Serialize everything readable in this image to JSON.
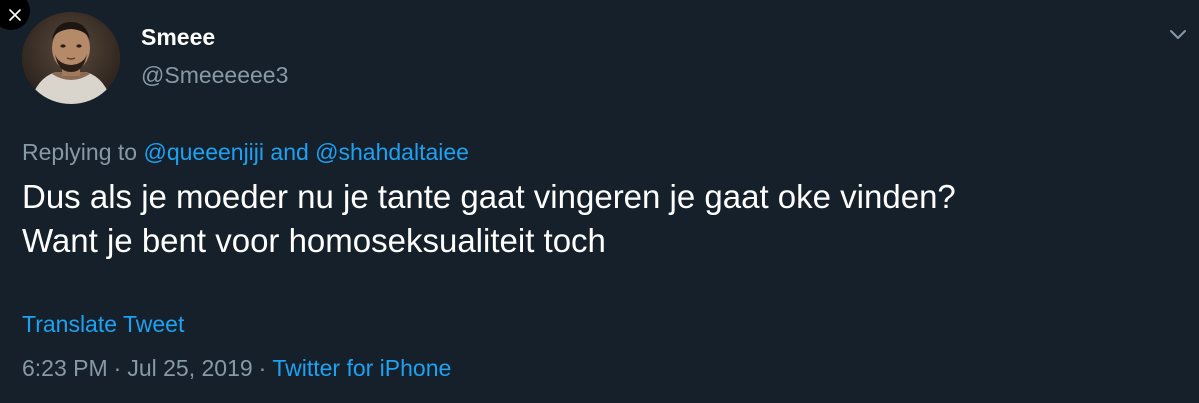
{
  "user": {
    "display_name": "Smeee",
    "handle": "@Smeeeeee3"
  },
  "reply": {
    "prefix": "Replying to",
    "mention_1": "@queeenjiji",
    "conjunction": "and",
    "mention_2": "@shahdaltaiee"
  },
  "tweet": {
    "lines": [
      "Dus als je moeder nu je tante gaat vingeren je gaat oke vinden?",
      "Want je bent voor homoseksualiteit toch"
    ]
  },
  "translate_label": "Translate Tweet",
  "meta": {
    "time": "6:23 PM",
    "separator": "·",
    "date": "Jul 25, 2019",
    "source": "Twitter for iPhone"
  },
  "colors": {
    "background": "#15202b",
    "accent": "#1da1f2",
    "secondary_text": "#8899a6",
    "primary_text": "#ffffff"
  },
  "icons": {
    "close": "close-icon",
    "more": "chevron-down-icon"
  }
}
